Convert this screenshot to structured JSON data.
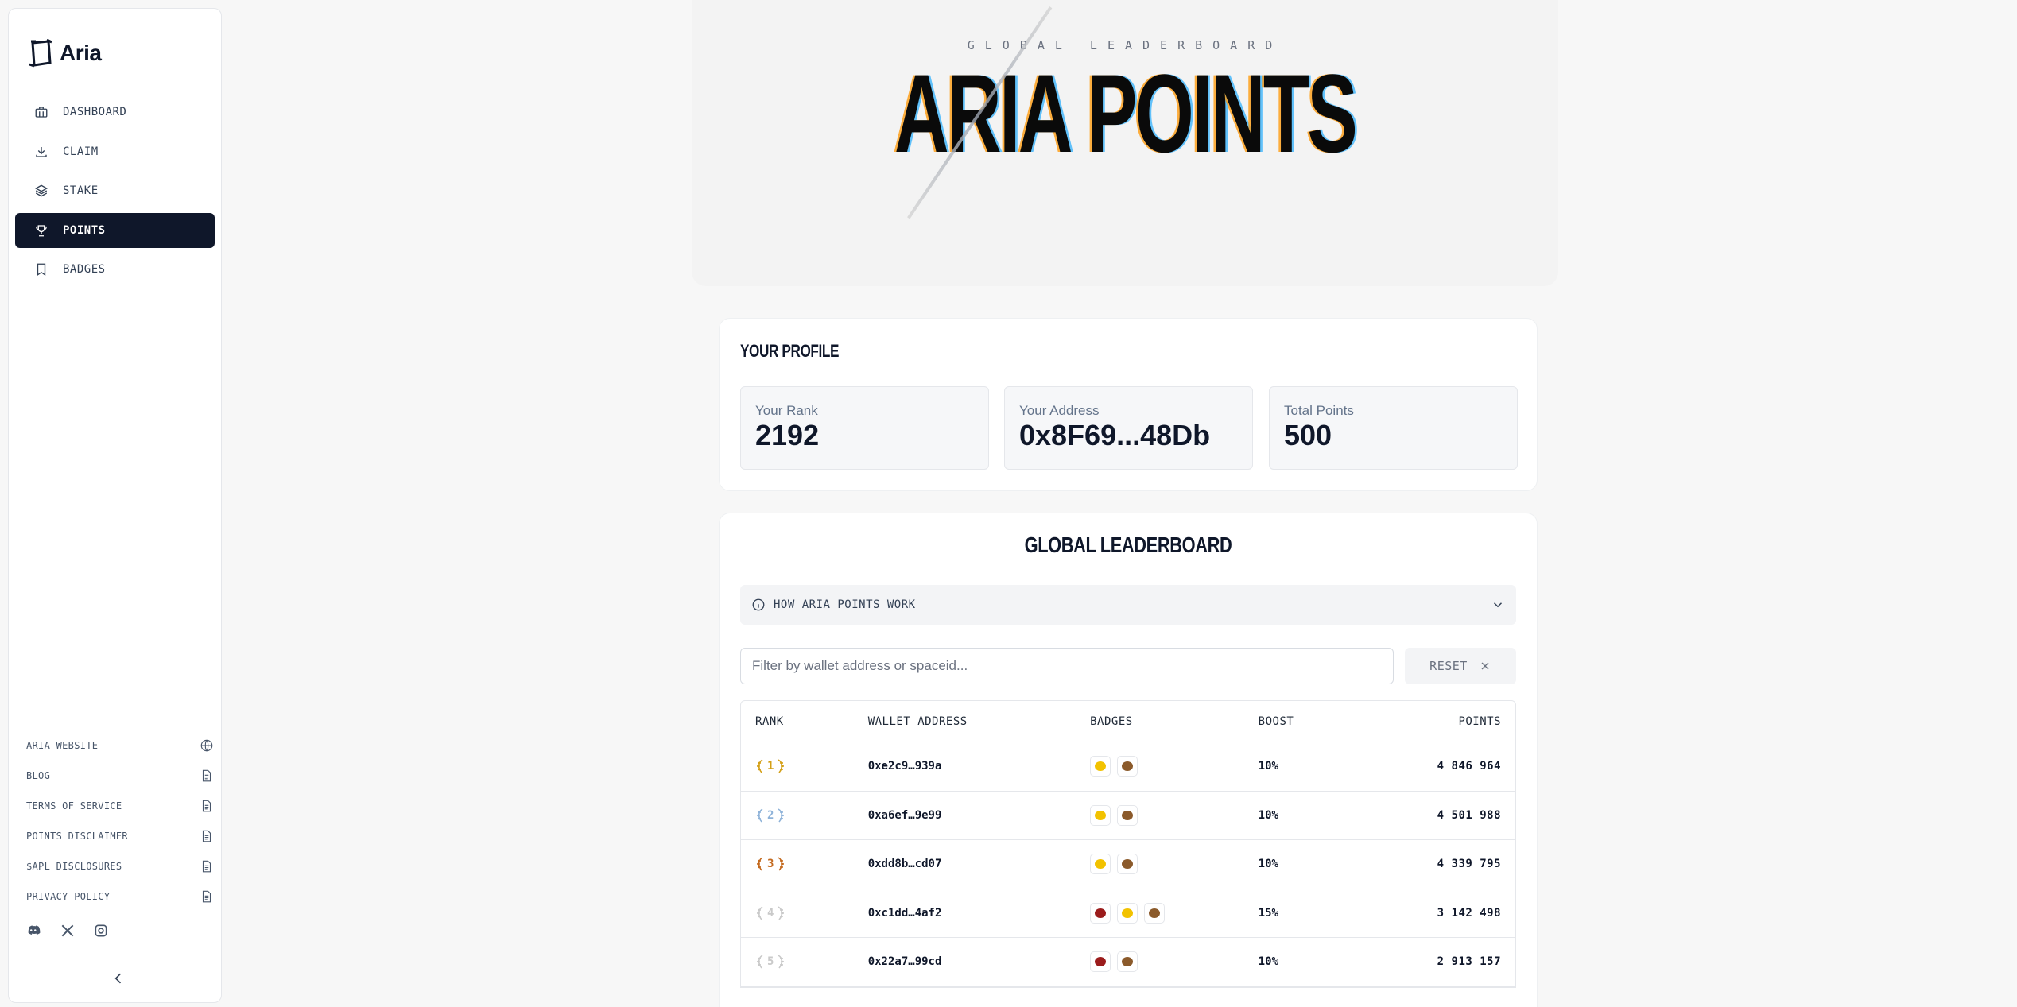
{
  "brand": {
    "name": "Aria"
  },
  "nav": {
    "items": [
      {
        "label": "DASHBOARD",
        "icon": "briefcase-icon",
        "active": false
      },
      {
        "label": "CLAIM",
        "icon": "download-icon",
        "active": false
      },
      {
        "label": "STAKE",
        "icon": "layers-icon",
        "active": false
      },
      {
        "label": "POINTS",
        "icon": "trophy-icon",
        "active": true
      },
      {
        "label": "BADGES",
        "icon": "bookmark-icon",
        "active": false
      }
    ]
  },
  "footer_links": [
    {
      "label": "ARIA WEBSITE",
      "icon": "globe-icon"
    },
    {
      "label": "BLOG",
      "icon": "document-icon"
    },
    {
      "label": "TERMS OF SERVICE",
      "icon": "document-icon"
    },
    {
      "label": "POINTS DISCLAIMER",
      "icon": "document-icon"
    },
    {
      "label": "$APL DISCLOSURES",
      "icon": "document-icon"
    },
    {
      "label": "PRIVACY POLICY",
      "icon": "document-icon"
    }
  ],
  "socials": [
    "discord-icon",
    "x-icon",
    "instagram-icon"
  ],
  "hero": {
    "subtitle": "GLOBAL LEADERBOARD",
    "title": "ARIA POINTS"
  },
  "profile": {
    "title": "YOUR PROFILE",
    "rank_label": "Your Rank",
    "rank_value": "2192",
    "address_label": "Your Address",
    "address_value": "0x8F69...48Db",
    "points_label": "Total Points",
    "points_value": "500"
  },
  "leaderboard": {
    "title": "GLOBAL LEADERBOARD",
    "accordion_label": "HOW ARIA POINTS WORK",
    "filter_placeholder": "Filter by wallet address or spaceid...",
    "reset_label": "RESET",
    "columns": {
      "rank": "RANK",
      "wallet": "WALLET ADDRESS",
      "badges": "BADGES",
      "boost": "BOOST",
      "points": "POINTS"
    },
    "rows": [
      {
        "rank": "1",
        "laurel": "#d4a017",
        "wallet": "0xe2c9…939a",
        "badges": [
          "#f2c200",
          "#8b5a2b"
        ],
        "boost": "10%",
        "points": "4 846 964"
      },
      {
        "rank": "2",
        "laurel": "#8fb3d9",
        "wallet": "0xa6ef…9e99",
        "badges": [
          "#f2c200",
          "#8b5a2b"
        ],
        "boost": "10%",
        "points": "4 501 988"
      },
      {
        "rank": "3",
        "laurel": "#c46a1f",
        "wallet": "0xdd8b…cd07",
        "badges": [
          "#f2c200",
          "#8b5a2b"
        ],
        "boost": "10%",
        "points": "4 339 795"
      },
      {
        "rank": "4",
        "laurel": "#c9c9c9",
        "wallet": "0xc1dd…4af2",
        "badges": [
          "#9b1c1c",
          "#f2c200",
          "#8b5a2b"
        ],
        "boost": "15%",
        "points": "3 142 498"
      },
      {
        "rank": "5",
        "laurel": "#c9c9c9",
        "wallet": "0x22a7…99cd",
        "badges": [
          "#9b1c1c",
          "#8b5a2b"
        ],
        "boost": "10%",
        "points": "2 913 157"
      }
    ]
  },
  "colors": {
    "accent": "#0f172a",
    "background": "#f7f7f7"
  }
}
